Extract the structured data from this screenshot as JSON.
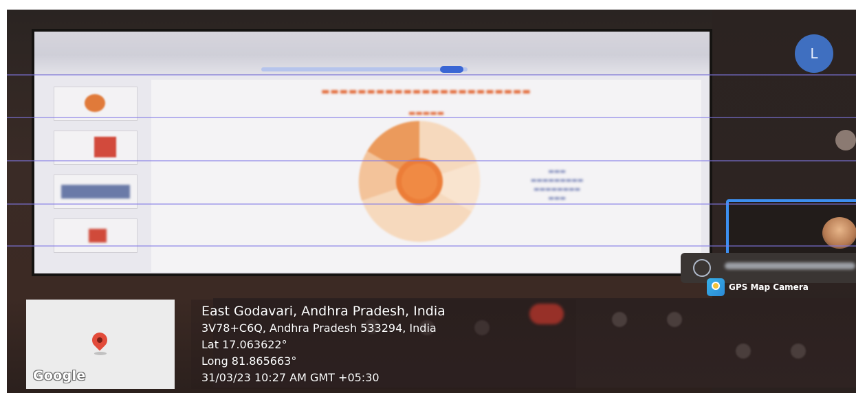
{
  "remote_avatar_initial": "L",
  "gps_badge": {
    "app_name": "GPS Map Camera",
    "icon": "gps-map-camera-icon"
  },
  "map_thumbnail": {
    "pin_icon": "map-pin-icon",
    "logo_text": "Google"
  },
  "location": {
    "place": "East Godavari, Andhra Pradesh, India",
    "plus_code_address": "3V78+C6Q, Andhra Pradesh 533294, India",
    "latitude": "Lat 17.063622°",
    "longitude": "Long 81.865663°",
    "datetime": "31/03/23 10:27 AM GMT +05:30"
  },
  "colors": {
    "pin_red": "#e24b3a",
    "meeting_tile_border": "#3d8ff0",
    "slide_accent": "#e26836",
    "avatar_blue": "#3f6fc0"
  }
}
